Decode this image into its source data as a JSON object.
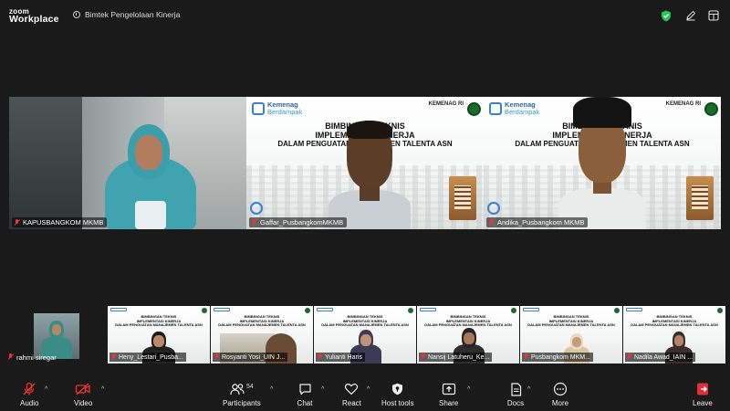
{
  "app": {
    "logo_line1": "zoom",
    "logo_line2": "Workplace",
    "meeting_title": "Bimtek Pengelolaan Kinerja"
  },
  "slide": {
    "brand_a": "Kemenag",
    "brand_b": "Berdampak",
    "org": "KEMENAG RI",
    "line1": "BIMBINGAN TEKNIS",
    "line2": "IMPLEMENTASI KINERJA",
    "line3": "DALAM PENGUATAN MANAJEMEN TALENTA ASN"
  },
  "main_tiles": [
    {
      "name": "KAPUSBANGKOM MKMB"
    },
    {
      "name": "Gaffar_PusbangkomMKMB"
    },
    {
      "name": "Andika_Pusbangkom MKMB"
    }
  ],
  "self_tile": {
    "name": "rahmi siregar"
  },
  "thumbnails": [
    {
      "name": "Heny_Lestari_Pusba..."
    },
    {
      "name": "Rosyanti Yosi_UIN J..."
    },
    {
      "name": "Yulianti Haris"
    },
    {
      "name": "Nansij Latuheru_Ke..."
    },
    {
      "name": "Pusbangkom MKM..."
    },
    {
      "name": "Nadila Awad_IAIN ..."
    }
  ],
  "toolbar": {
    "audio": "Audio",
    "video": "Video",
    "participants": "Participants",
    "participants_count": "54",
    "chat": "Chat",
    "react": "React",
    "host_tools": "Host tools",
    "share": "Share",
    "docs": "Docs",
    "more": "More",
    "leave": "Leave"
  },
  "colors": {
    "accent_green": "#23c55e",
    "mute_red": "#e33",
    "leave_red": "#e0313a"
  }
}
